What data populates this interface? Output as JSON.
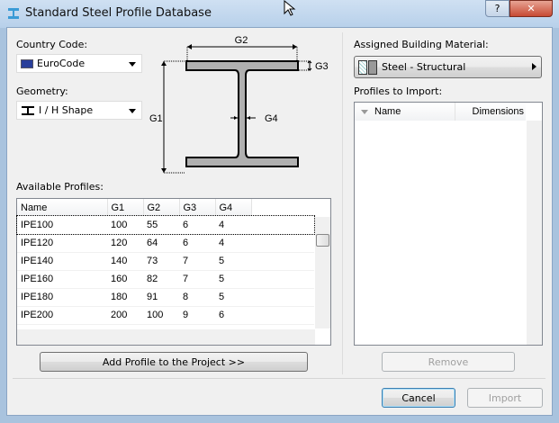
{
  "window": {
    "title": "Standard Steel Profile Database",
    "help": "?",
    "close": "✕"
  },
  "country": {
    "label": "Country Code:",
    "value": "EuroCode"
  },
  "geometry": {
    "label": "Geometry:",
    "value": "I / H Shape"
  },
  "diagram": {
    "g1": "G1",
    "g2": "G2",
    "g3": "G3",
    "g4": "G4"
  },
  "available": {
    "label": "Available Profiles:",
    "columns": [
      "Name",
      "G1",
      "G2",
      "G3",
      "G4"
    ],
    "rows": [
      [
        "IPE100",
        "100",
        "55",
        "6",
        "4"
      ],
      [
        "IPE120",
        "120",
        "64",
        "6",
        "4"
      ],
      [
        "IPE140",
        "140",
        "73",
        "7",
        "5"
      ],
      [
        "IPE160",
        "160",
        "82",
        "7",
        "5"
      ],
      [
        "IPE180",
        "180",
        "91",
        "8",
        "5"
      ],
      [
        "IPE200",
        "200",
        "100",
        "9",
        "6"
      ]
    ]
  },
  "add_button": "Add Profile to the Project >>",
  "material": {
    "label": "Assigned Building Material:",
    "value": "Steel - Structural"
  },
  "import_list": {
    "label": "Profiles to Import:",
    "columns": [
      "Name",
      "Dimensions"
    ]
  },
  "remove_button": "Remove",
  "cancel_button": "Cancel",
  "import_button": "Import"
}
